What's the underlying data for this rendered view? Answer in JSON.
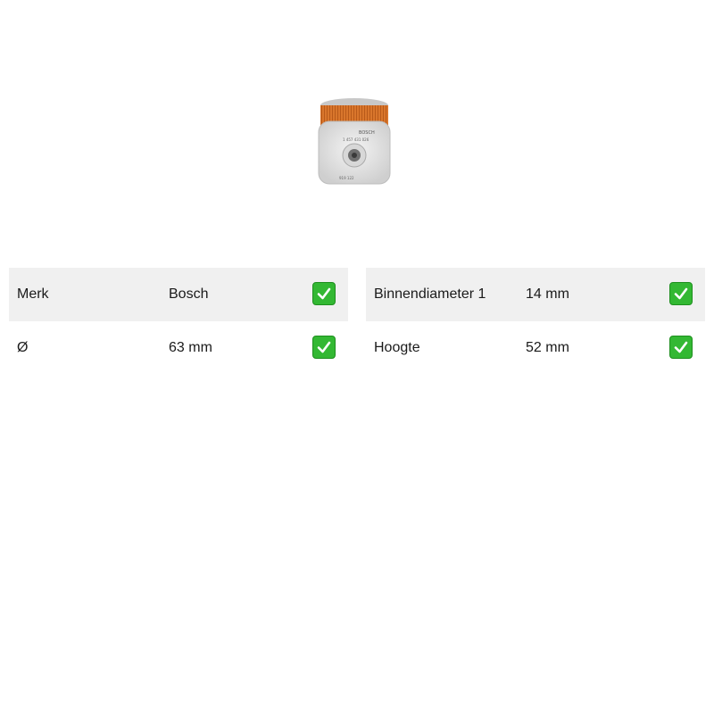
{
  "product": {
    "image_icon": "fuel-filter-image",
    "brand_print": "BOSCH",
    "part_number_print": "1 457 431 026",
    "code_print": "919 122"
  },
  "specs_left": [
    {
      "label": "Merk",
      "value": "Bosch",
      "icon": "check-icon"
    },
    {
      "label": "Ø",
      "value": "63 mm",
      "icon": "check-icon"
    }
  ],
  "specs_right": [
    {
      "label": "Binnendiameter 1",
      "value": "14 mm",
      "icon": "check-icon"
    },
    {
      "label": "Hoogte",
      "value": "52 mm",
      "icon": "check-icon"
    }
  ],
  "colors": {
    "row_shade": "#f0f0f0",
    "check_green": "#33b833",
    "filter_paper": "#d9762c",
    "filter_cap": "#e4e4e4"
  }
}
